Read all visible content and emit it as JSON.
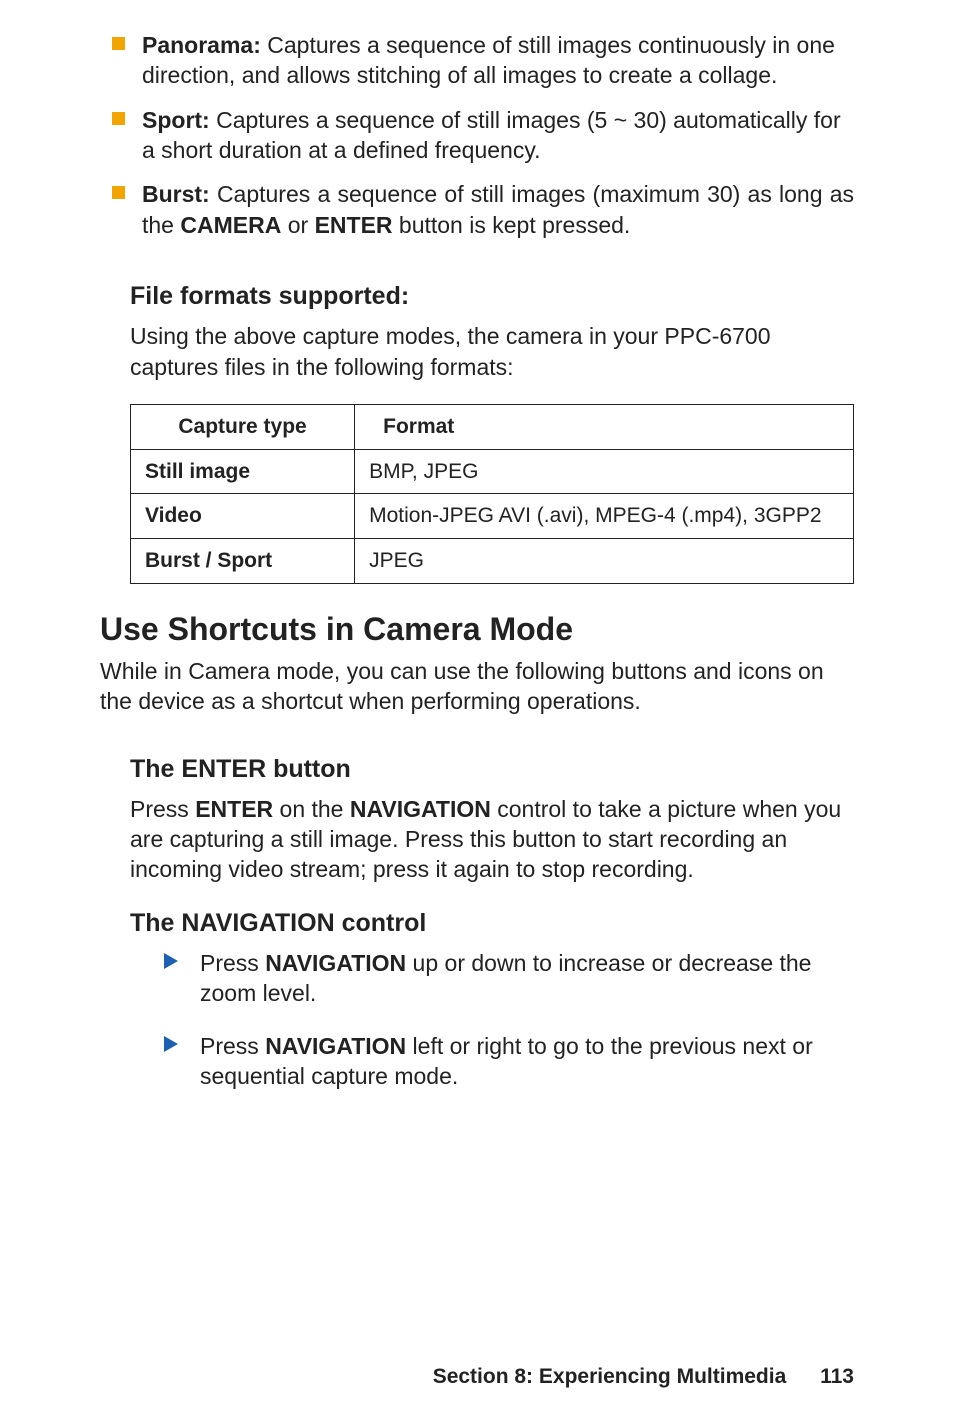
{
  "bullets": [
    {
      "title": "Panorama:",
      "text": "Captures a sequence of still images continuously in one direction, and allows stitching of all images to create a collage."
    },
    {
      "title": "Sport:",
      "text": "Captures a sequence of still images (5 ~ 30) automatically for a short duration at a defined frequency."
    },
    {
      "title": "Burst:",
      "pre": "Captures a sequence of still images (maximum 30) as long as the ",
      "kw1": "CAMERA",
      "mid": " or ",
      "kw2": "ENTER",
      "post": " button is kept pressed."
    }
  ],
  "file_formats": {
    "heading": "File formats supported:",
    "intro": "Using the above capture modes, the camera in your PPC-6700 captures files in the following formats:",
    "table": {
      "head": [
        "Capture type",
        "Format"
      ],
      "rows": [
        {
          "k": "Still image",
          "v": "BMP, JPEG"
        },
        {
          "k": "Video",
          "v": "Motion-JPEG AVI (.avi), MPEG-4 (.mp4), 3GPP2"
        },
        {
          "k": "Burst / Sport",
          "v": "JPEG"
        }
      ]
    }
  },
  "shortcuts": {
    "heading": "Use Shortcuts in Camera Mode",
    "intro": "While in Camera mode, you can use the following buttons and icons on the device as a shortcut when performing operations."
  },
  "enter": {
    "heading": "The ENTER button",
    "pre": "Press ",
    "kw1": "ENTER",
    "mid1": " on the ",
    "kw2": "NAVIGATION",
    "post": " control to take a picture when you are capturing a still image. Press this button to start recording an incoming video stream; press it again to stop recording."
  },
  "nav": {
    "heading": "The NAVIGATION control",
    "items": [
      {
        "pre": "Press ",
        "kw": "NAVIGATION",
        "post": " up or down to increase or decrease the zoom level."
      },
      {
        "pre": "Press ",
        "kw": "NAVIGATION",
        "post": " left or right to go to the previous next or sequential capture mode."
      }
    ]
  },
  "footer": {
    "section": "Section 8: Experiencing Multimedia",
    "page": "113"
  }
}
